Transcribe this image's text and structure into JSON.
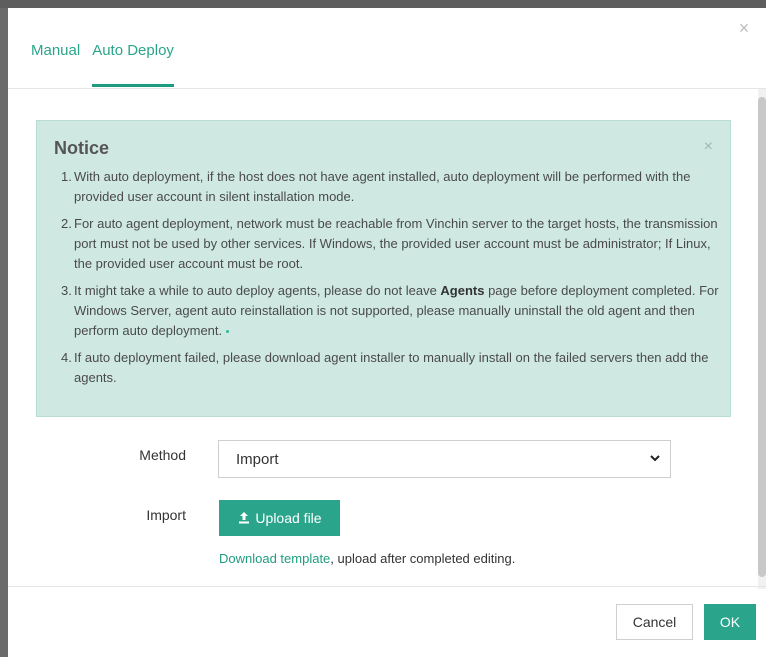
{
  "tabs": [
    {
      "label": "Manual"
    },
    {
      "label": "Auto Deploy",
      "active": true
    }
  ],
  "notice": {
    "title": "Notice",
    "items": [
      {
        "num": "1.",
        "text": "With auto deployment, if the host does not have agent installed, auto deployment will be performed with the provided user account in silent installation mode."
      },
      {
        "num": "2.",
        "text": "For auto agent deployment, network must be reachable from Vinchin server to the target hosts, the transmission port must not be used by other services. If Windows, the provided user account must be administrator; If Linux, the provided user account must be root."
      },
      {
        "num": "3.",
        "text_before": "It might take a while to auto deploy agents, please do not leave ",
        "bold": "Agents",
        "text_after": " page before deployment completed. For Windows Server, agent auto reinstallation is not supported, please manually uninstall the old agent and then perform auto deployment."
      },
      {
        "num": "4.",
        "text": "If auto deployment failed, please download agent installer to manually install on the failed servers then add the agents."
      }
    ]
  },
  "form": {
    "method_label": "Method",
    "method_value": "Import",
    "import_label": "Import",
    "upload_label": "Upload file",
    "template_link": "Download template",
    "template_suffix": ", upload after completed editing."
  },
  "footer": {
    "cancel": "Cancel",
    "ok": "OK"
  },
  "colors": {
    "accent": "#2aa58b",
    "notice_bg": "#cfe9e2"
  },
  "icons": [
    "close-icon",
    "notice-close-icon",
    "chevron-down-icon",
    "upload-icon"
  ]
}
